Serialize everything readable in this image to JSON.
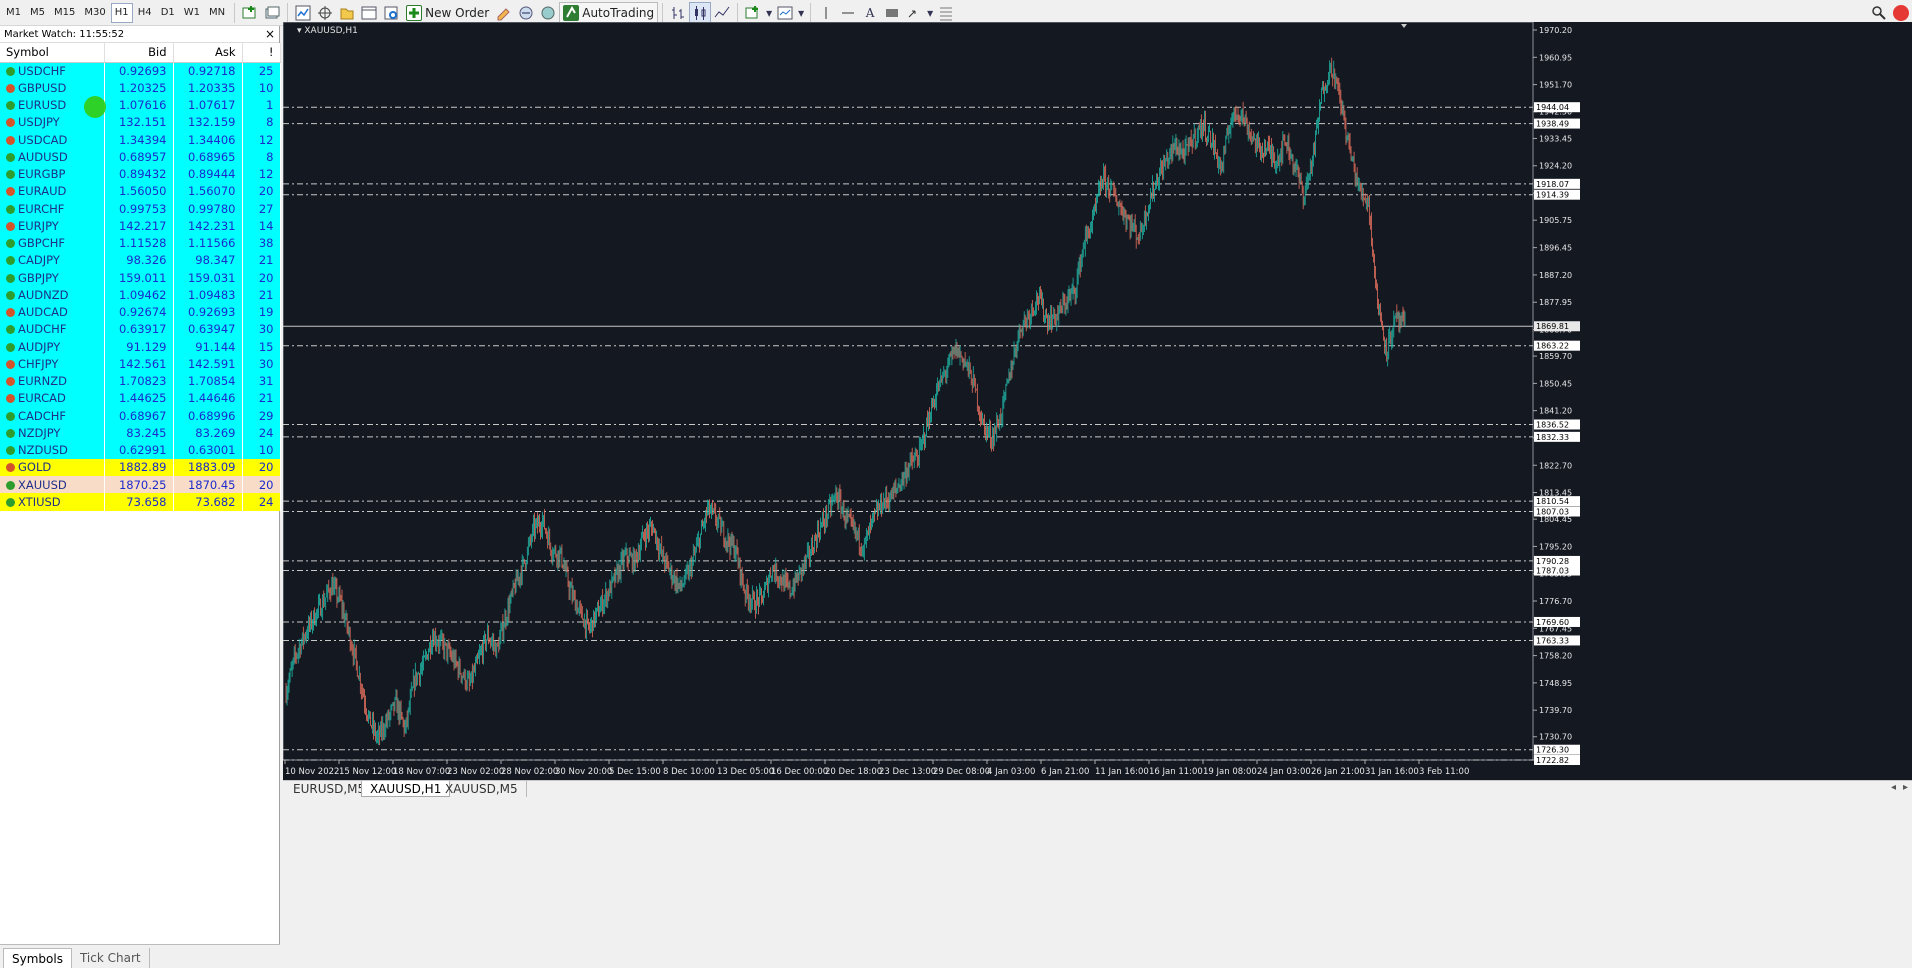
{
  "toolbar": {
    "timeframes": [
      "M1",
      "M5",
      "M15",
      "M30",
      "H1",
      "H4",
      "D1",
      "W1",
      "MN"
    ],
    "active_timeframe": "H1",
    "new_order_label": "New Order",
    "autotrading_label": "AutoTrading"
  },
  "market_watch": {
    "title": "Market Watch: 11:55:52",
    "close_label": "×",
    "columns": [
      "Symbol",
      "Bid",
      "Ask",
      "!"
    ],
    "rows": [
      {
        "symbol": "USDCHF",
        "bid": "0.92693",
        "ask": "0.92718",
        "spread": "25",
        "dir": "up",
        "bg": "#00ffff"
      },
      {
        "symbol": "GBPUSD",
        "bid": "1.20325",
        "ask": "1.20335",
        "spread": "10",
        "dir": "down",
        "bg": "#00ffff"
      },
      {
        "symbol": "EURUSD",
        "bid": "1.07616",
        "ask": "1.07617",
        "spread": "1",
        "dir": "up",
        "bg": "#00ffff"
      },
      {
        "symbol": "USDJPY",
        "bid": "132.151",
        "ask": "132.159",
        "spread": "8",
        "dir": "down",
        "bg": "#00ffff"
      },
      {
        "symbol": "USDCAD",
        "bid": "1.34394",
        "ask": "1.34406",
        "spread": "12",
        "dir": "down",
        "bg": "#00ffff"
      },
      {
        "symbol": "AUDUSD",
        "bid": "0.68957",
        "ask": "0.68965",
        "spread": "8",
        "dir": "up",
        "bg": "#00ffff"
      },
      {
        "symbol": "EURGBP",
        "bid": "0.89432",
        "ask": "0.89444",
        "spread": "12",
        "dir": "up",
        "bg": "#00ffff"
      },
      {
        "symbol": "EURAUD",
        "bid": "1.56050",
        "ask": "1.56070",
        "spread": "20",
        "dir": "down",
        "bg": "#00ffff"
      },
      {
        "symbol": "EURCHF",
        "bid": "0.99753",
        "ask": "0.99780",
        "spread": "27",
        "dir": "up",
        "bg": "#00ffff"
      },
      {
        "symbol": "EURJPY",
        "bid": "142.217",
        "ask": "142.231",
        "spread": "14",
        "dir": "down",
        "bg": "#00ffff"
      },
      {
        "symbol": "GBPCHF",
        "bid": "1.11528",
        "ask": "1.11566",
        "spread": "38",
        "dir": "up",
        "bg": "#00ffff"
      },
      {
        "symbol": "CADJPY",
        "bid": "98.326",
        "ask": "98.347",
        "spread": "21",
        "dir": "up",
        "bg": "#00ffff"
      },
      {
        "symbol": "GBPJPY",
        "bid": "159.011",
        "ask": "159.031",
        "spread": "20",
        "dir": "up",
        "bg": "#00ffff"
      },
      {
        "symbol": "AUDNZD",
        "bid": "1.09462",
        "ask": "1.09483",
        "spread": "21",
        "dir": "up",
        "bg": "#00ffff"
      },
      {
        "symbol": "AUDCAD",
        "bid": "0.92674",
        "ask": "0.92693",
        "spread": "19",
        "dir": "down",
        "bg": "#00ffff"
      },
      {
        "symbol": "AUDCHF",
        "bid": "0.63917",
        "ask": "0.63947",
        "spread": "30",
        "dir": "up",
        "bg": "#00ffff"
      },
      {
        "symbol": "AUDJPY",
        "bid": "91.129",
        "ask": "91.144",
        "spread": "15",
        "dir": "up",
        "bg": "#00ffff"
      },
      {
        "symbol": "CHFJPY",
        "bid": "142.561",
        "ask": "142.591",
        "spread": "30",
        "dir": "down",
        "bg": "#00ffff"
      },
      {
        "symbol": "EURNZD",
        "bid": "1.70823",
        "ask": "1.70854",
        "spread": "31",
        "dir": "down",
        "bg": "#00ffff"
      },
      {
        "symbol": "EURCAD",
        "bid": "1.44625",
        "ask": "1.44646",
        "spread": "21",
        "dir": "down",
        "bg": "#00ffff"
      },
      {
        "symbol": "CADCHF",
        "bid": "0.68967",
        "ask": "0.68996",
        "spread": "29",
        "dir": "up",
        "bg": "#00ffff"
      },
      {
        "symbol": "NZDJPY",
        "bid": "83.245",
        "ask": "83.269",
        "spread": "24",
        "dir": "up",
        "bg": "#00ffff"
      },
      {
        "symbol": "NZDUSD",
        "bid": "0.62991",
        "ask": "0.63001",
        "spread": "10",
        "dir": "up",
        "bg": "#00ffff"
      },
      {
        "symbol": "GOLD",
        "bid": "1882.89",
        "ask": "1883.09",
        "spread": "20",
        "dir": "down",
        "bg": "#ffff00"
      },
      {
        "symbol": "XAUUSD",
        "bid": "1870.25",
        "ask": "1870.45",
        "spread": "20",
        "dir": "up",
        "bg": "#f8dcc8"
      },
      {
        "symbol": "XTIUSD",
        "bid": "73.658",
        "ask": "73.682",
        "spread": "24",
        "dir": "up",
        "bg": "#ffff00"
      }
    ],
    "tabs": [
      "Symbols",
      "Tick Chart"
    ],
    "active_tab": "Symbols"
  },
  "chart_tabs": [
    "EURUSD,M5",
    "XAUUSD,H1",
    "XAUUSD,M5"
  ],
  "active_chart_tab": "XAUUSD,H1",
  "colors": {
    "bg": "#141821",
    "up": "#1fb5a5",
    "down": "#e5705e",
    "grid": "#c8c8c8"
  },
  "chart_data": {
    "type": "candlestick",
    "title": "XAUUSD,H1",
    "ylim": [
      1722.82,
      1970.2
    ],
    "y_ticks": [
      "1970.20",
      "1960.95",
      "1951.70",
      "1942.50",
      "1933.45",
      "1924.20",
      "1914.95",
      "1905.75",
      "1896.45",
      "1887.20",
      "1877.95",
      "1868.70",
      "1859.70",
      "1850.45",
      "1841.20",
      "1831.95",
      "1822.70",
      "1813.45",
      "1804.45",
      "1795.20",
      "1785.95",
      "1776.70",
      "1767.45",
      "1758.20",
      "1748.95",
      "1739.70",
      "1730.70",
      "1722.82"
    ],
    "x_labels": [
      "10 Nov 2022",
      "15 Nov 12:00",
      "18 Nov 07:00",
      "23 Nov 02:00",
      "28 Nov 02:00",
      "30 Nov 20:00",
      "5 Dec 15:00",
      "8 Dec 10:00",
      "13 Dec 05:00",
      "16 Dec 00:00",
      "20 Dec 18:00",
      "23 Dec 13:00",
      "29 Dec 08:00",
      "4 Jan 03:00",
      "6 Jan 21:00",
      "11 Jan 16:00",
      "16 Jan 11:00",
      "19 Jan 08:00",
      "24 Jan 03:00",
      "26 Jan 21:00",
      "31 Jan 16:00",
      "3 Feb 11:00"
    ],
    "levels": [
      "1944.04",
      "1938.49",
      "1918.07",
      "1914.39",
      "1869.81",
      "1863.22",
      "1836.52",
      "1832.33",
      "1810.54",
      "1807.03",
      "1790.28",
      "1787.03",
      "1769.60",
      "1763.33",
      "1726.30",
      "1722.82"
    ],
    "current_price": "1869.81",
    "price_path": [
      1746,
      1758,
      1765,
      1771,
      1776,
      1782,
      1776,
      1764,
      1751,
      1737,
      1730,
      1736,
      1742,
      1733,
      1750,
      1755,
      1765,
      1762,
      1758,
      1753,
      1748,
      1757,
      1765,
      1760,
      1772,
      1782,
      1790,
      1801,
      1804,
      1794,
      1792,
      1780,
      1773,
      1767,
      1773,
      1779,
      1785,
      1792,
      1790,
      1799,
      1802,
      1792,
      1786,
      1781,
      1787,
      1797,
      1808,
      1804,
      1798,
      1794,
      1780,
      1776,
      1778,
      1788,
      1784,
      1780,
      1786,
      1792,
      1800,
      1806,
      1813,
      1805,
      1800,
      1795,
      1804,
      1810,
      1812,
      1817,
      1823,
      1826,
      1838,
      1848,
      1855,
      1862,
      1858,
      1850,
      1836,
      1832,
      1840,
      1855,
      1869,
      1874,
      1880,
      1872,
      1873,
      1878,
      1882,
      1898,
      1906,
      1920,
      1916,
      1910,
      1905,
      1900,
      1911,
      1920,
      1926,
      1931,
      1928,
      1934,
      1938,
      1932,
      1923,
      1940,
      1943,
      1936,
      1930,
      1930,
      1926,
      1933,
      1924,
      1914,
      1928,
      1950,
      1958,
      1946,
      1929,
      1916,
      1912,
      1878,
      1862,
      1872,
      1870
    ]
  }
}
